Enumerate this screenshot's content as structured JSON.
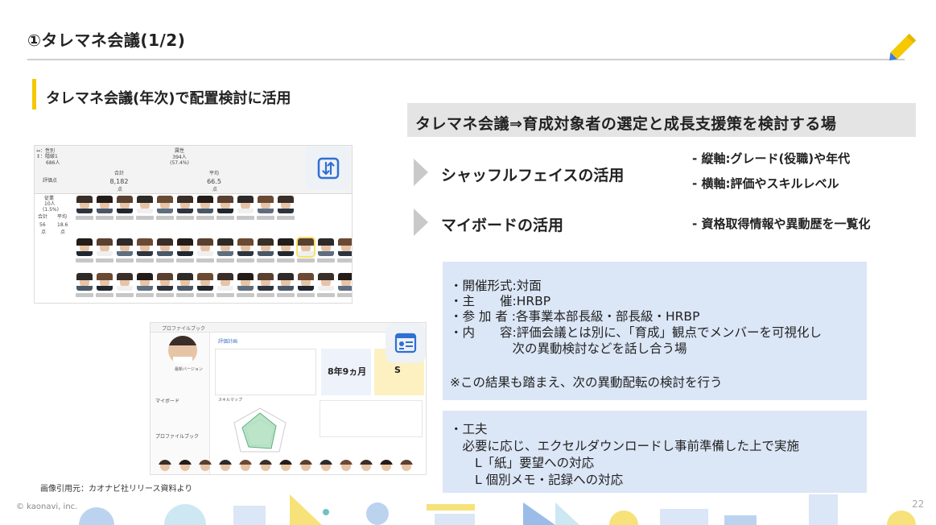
{
  "title": "①タレマネ会議(1/2)",
  "section_title": "タレマネ会議(年次)で配置検討に活用",
  "headline": "タレマネ会議⇒育成対象者の選定と成長支援策を検討する場",
  "features": [
    {
      "label": "シャッフルフェイスの活用",
      "bullets": [
        "- 縦軸:グレード(役職)や年代",
        "- 横軸:評価やスキルレベル"
      ]
    },
    {
      "label": "マイボードの活用",
      "bullets": [
        "- 資格取得情報や異動歴を一覧化"
      ]
    }
  ],
  "info": {
    "lines": [
      "・開催形式:対面",
      "・主　　催:HRBP",
      "・参 加 者 :各事業本部長級・部長級・HRBP",
      "・内　　容:評価会議とは別に、「育成」観点でメンバーを可視化し",
      "　　　　　次の異動検討などを話し合う場",
      "",
      "※この結果も踏まえ、次の異動配転の検討を行う"
    ]
  },
  "tips": {
    "lines": [
      "・工夫",
      "　必要に応じ、エクセルダウンロードし事前準備した上で実施",
      "　　L「紙」要望への対応",
      "　　L 個別メモ・記録への対応"
    ]
  },
  "matrix": {
    "axis_top": "↔：性別\n↕：階級1",
    "axis_count": "686人",
    "group_label": "属性",
    "group_count": "394人",
    "group_pct": "(57.4%)",
    "col_total": "合計",
    "col_avg": "平均",
    "total_value": "8,182",
    "avg_value": "66.5",
    "unit_points": "点",
    "row_label": "評価点",
    "side_group": "従業",
    "side_count": "10人",
    "side_pct": "(1.5%)",
    "side_total_label": "合計",
    "side_avg_label": "平均",
    "side_total": "56",
    "side_avg": "18.6",
    "side_unit1": "点",
    "side_unit2": "点"
  },
  "profile": {
    "app_name": "プロファイルブック",
    "name": "最新バージョン",
    "section_eval": "評価計画",
    "section_skill": "スキルマップ",
    "menu_myboard": "マイボード",
    "menu_profile": "プロファイルブック",
    "tenure": "8年9ヵ月",
    "grade": "S"
  },
  "credit": "画像引用元：カオナビ社リリース資料より",
  "copyright": "© kaonavi, inc.",
  "page_number": "22",
  "colors": {
    "accent_yellow": "#f5c800",
    "box_blue": "#dbe6f6",
    "icon_blue": "#2f6fd6"
  },
  "icons": [
    "pencil-icon",
    "swap-vertical-icon",
    "profile-card-icon"
  ]
}
